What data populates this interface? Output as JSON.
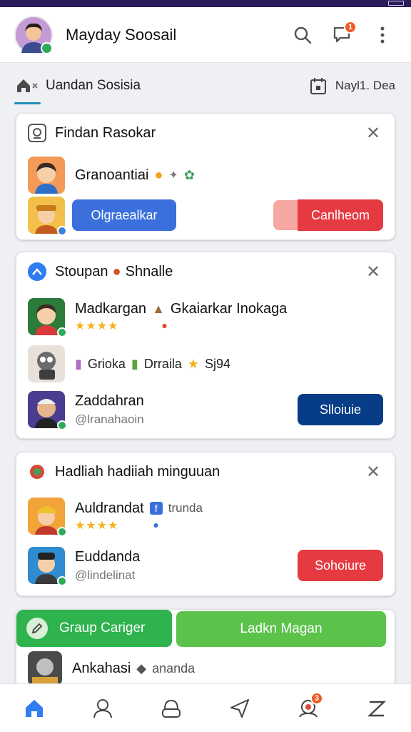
{
  "app": {
    "title": "Mayday Soosail",
    "notification_count": "1"
  },
  "subnav": {
    "active_tab": "Uandan Sosisia",
    "date_label": "Nayl1. Dea"
  },
  "card1": {
    "title": "Findan Rasokar",
    "row1_name": "Granoantiai",
    "primary_button": "Olgraealkar",
    "secondary_button": "Canlheom"
  },
  "card2": {
    "title": "Stoupan",
    "title_tail": "Shnalle",
    "row1_name": "Madkargan",
    "row1_extra": "Gkaiarkar Inokaga",
    "row1_stars": "★★★★",
    "row2_a": "Grioka",
    "row2_b": "Drraila",
    "row2_c": "Sj94",
    "row3_name": "Zaddahran",
    "row3_handle": "@lranahaoin",
    "button": "Slloiuie"
  },
  "card3": {
    "title": "Hadliah hadiiah minguuan",
    "row1_name": "Auldrandat",
    "row1_extra": "trunda",
    "row1_stars": "★★★★",
    "row2_name": "Euddanda",
    "row2_handle": "@lindelinat",
    "button": "Sohoiure"
  },
  "card4": {
    "button_left": "Graup Cariger",
    "button_right": "Ladkn Magan",
    "row1_name": "Ankahasi",
    "row1_extra": "ananda"
  },
  "bottom_nav": {
    "badge": "3"
  },
  "colors": {
    "accent_blue": "#3b6fdc",
    "accent_red": "#e63a42",
    "accent_navy": "#073c87",
    "accent_green": "#2eb34f",
    "status_bar": "#2b1d5c"
  },
  "icons": [
    "search-icon",
    "chat-icon",
    "more-icon",
    "home-icon",
    "calendar-icon",
    "close-icon",
    "profile-icon",
    "groups-icon",
    "send-icon",
    "alerts-icon",
    "z-icon"
  ]
}
